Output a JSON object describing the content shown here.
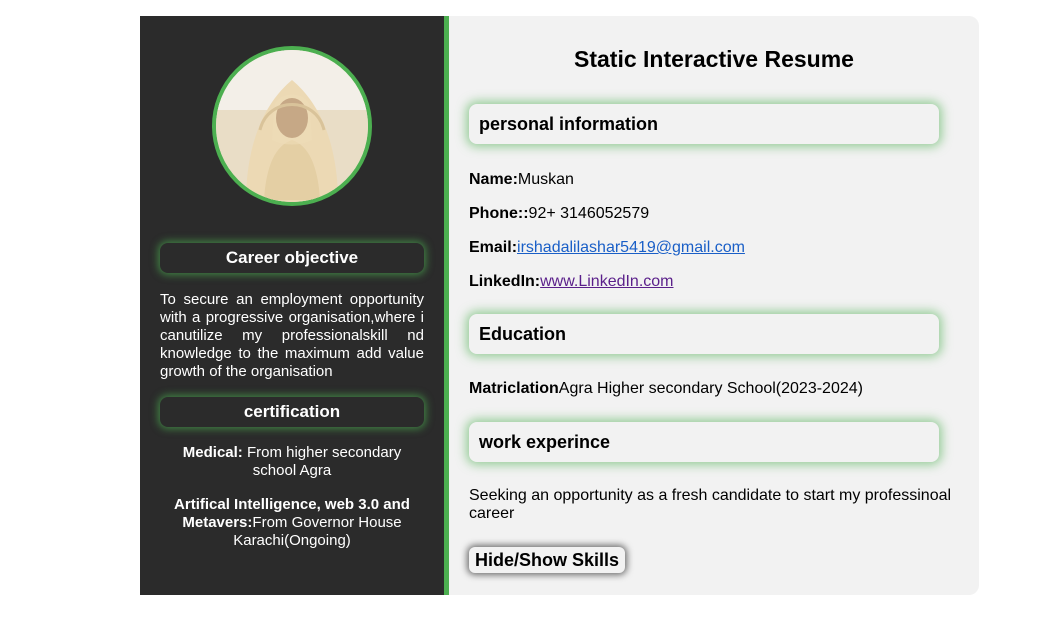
{
  "sidebar": {
    "photo_alt": "profile photo",
    "career_heading": "Career objective",
    "career_text": "To secure an employment opportunity with a progressive organisation,where i canutilize my professionalskill nd knowledge to the maximum add value growth of the organisation",
    "cert_heading": "certification",
    "certs": [
      {
        "title": "Medical:",
        "detail": " From higher secondary school Agra"
      },
      {
        "title": "Artifical Intelligence, web 3.0 and Metavers:",
        "detail": "From Governor House Karachi(Ongoing)"
      }
    ]
  },
  "main": {
    "title": "Static Interactive Resume",
    "personal_heading": "personal information",
    "personal": {
      "name_label": "Name:",
      "name_value": "Muskan",
      "phone_label": "Phone::",
      "phone_value": "92+ 3146052579",
      "email_label": "Email:",
      "email_value": "irshadalilashar5419@gmail.com",
      "linkedin_label": "LinkedIn:",
      "linkedin_value": "www.LinkedIn.com"
    },
    "education_heading": "Education",
    "education": {
      "label": "Matriclation",
      "value": "Agra Higher secondary School(2023-2024)"
    },
    "work_heading": "work experince",
    "work_text": "Seeking an opportunity as a fresh candidate to start my professinoal career",
    "skills_button": "Hide/Show Skills"
  },
  "colors": {
    "accent": "#4caf50",
    "sidebar_bg": "#2b2b2b",
    "main_bg": "#f2f2f2",
    "link": "#1a5fc7",
    "visited_link": "#5a1f8a"
  }
}
